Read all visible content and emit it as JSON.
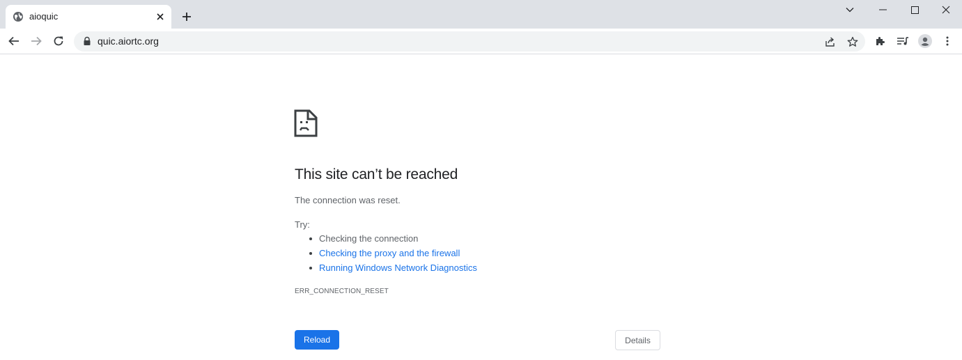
{
  "tab": {
    "title": "aioquic",
    "favicon": "globe-icon",
    "close_icon": "close-icon",
    "new_tab_icon": "plus-icon"
  },
  "window_controls": {
    "tab_search_icon": "chevron-down-icon",
    "minimize_icon": "minimize-icon",
    "maximize_icon": "maximize-icon",
    "close_icon": "close-icon"
  },
  "toolbar": {
    "url": "quic.aiortc.org",
    "icons": [
      "back-arrow-icon",
      "forward-arrow-icon",
      "reload-icon",
      "lock-icon",
      "share-icon",
      "star-icon",
      "puzzle-icon",
      "media-queue-icon",
      "profile-icon",
      "kebab-menu-icon"
    ]
  },
  "error_page": {
    "title": "This site can’t be reached",
    "description": "The connection was reset.",
    "try_label": "Try:",
    "suggestions": [
      {
        "text": "Checking the connection",
        "is_link": false
      },
      {
        "text": "Checking the proxy and the firewall",
        "is_link": true
      },
      {
        "text": "Running Windows Network Diagnostics",
        "is_link": true
      }
    ],
    "error_code": "ERR_CONNECTION_RESET",
    "reload_label": "Reload",
    "details_label": "Details"
  },
  "colors": {
    "tabstrip_bg": "#dee1e6",
    "omnibox_bg": "#f1f3f4",
    "accent": "#1a73e8",
    "text_primary": "#202124",
    "text_secondary": "#5f6368"
  }
}
